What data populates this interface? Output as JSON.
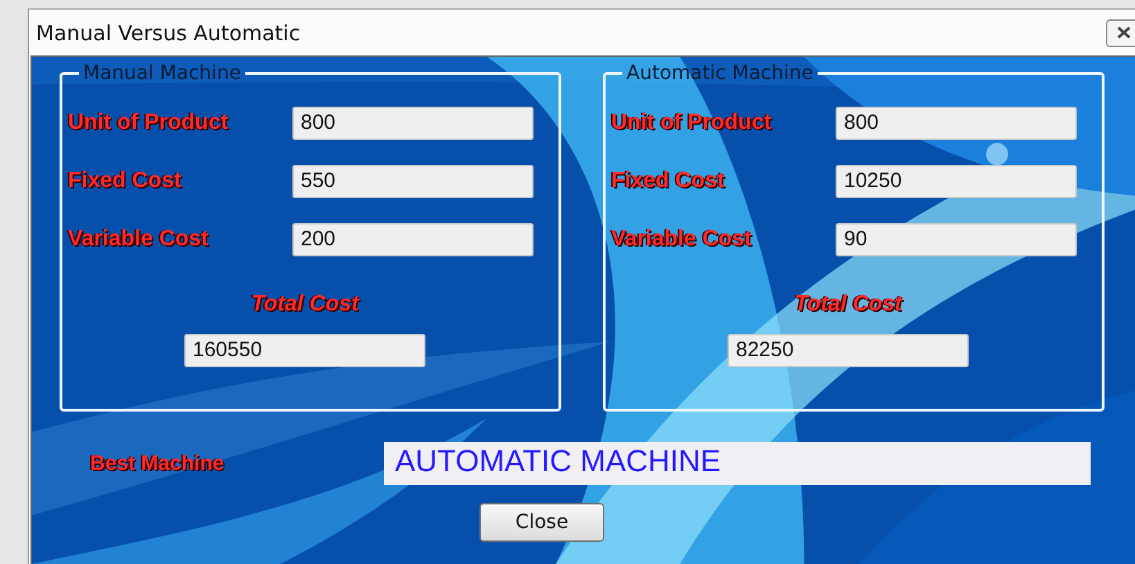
{
  "window": {
    "title": "Manual Versus Automatic"
  },
  "groups": [
    {
      "title": "Manual Machine",
      "fields": [
        {
          "label": "Unit of Product",
          "value": "800"
        },
        {
          "label": "Fixed Cost",
          "value": "550"
        },
        {
          "label": "Variable Cost",
          "value": "200"
        }
      ],
      "total_label": "Total Cost",
      "total_value": "160550"
    },
    {
      "title": "Automatic Machine",
      "fields": [
        {
          "label": "Unit of Product",
          "value": "800"
        },
        {
          "label": "Fixed Cost",
          "value": "10250"
        },
        {
          "label": "Variable Cost",
          "value": "90"
        }
      ],
      "total_label": "Total Cost",
      "total_value": "82250"
    }
  ],
  "best": {
    "label": "Best Machine",
    "value": "AUTOMATIC MACHINE"
  },
  "buttons": [
    "Close"
  ]
}
